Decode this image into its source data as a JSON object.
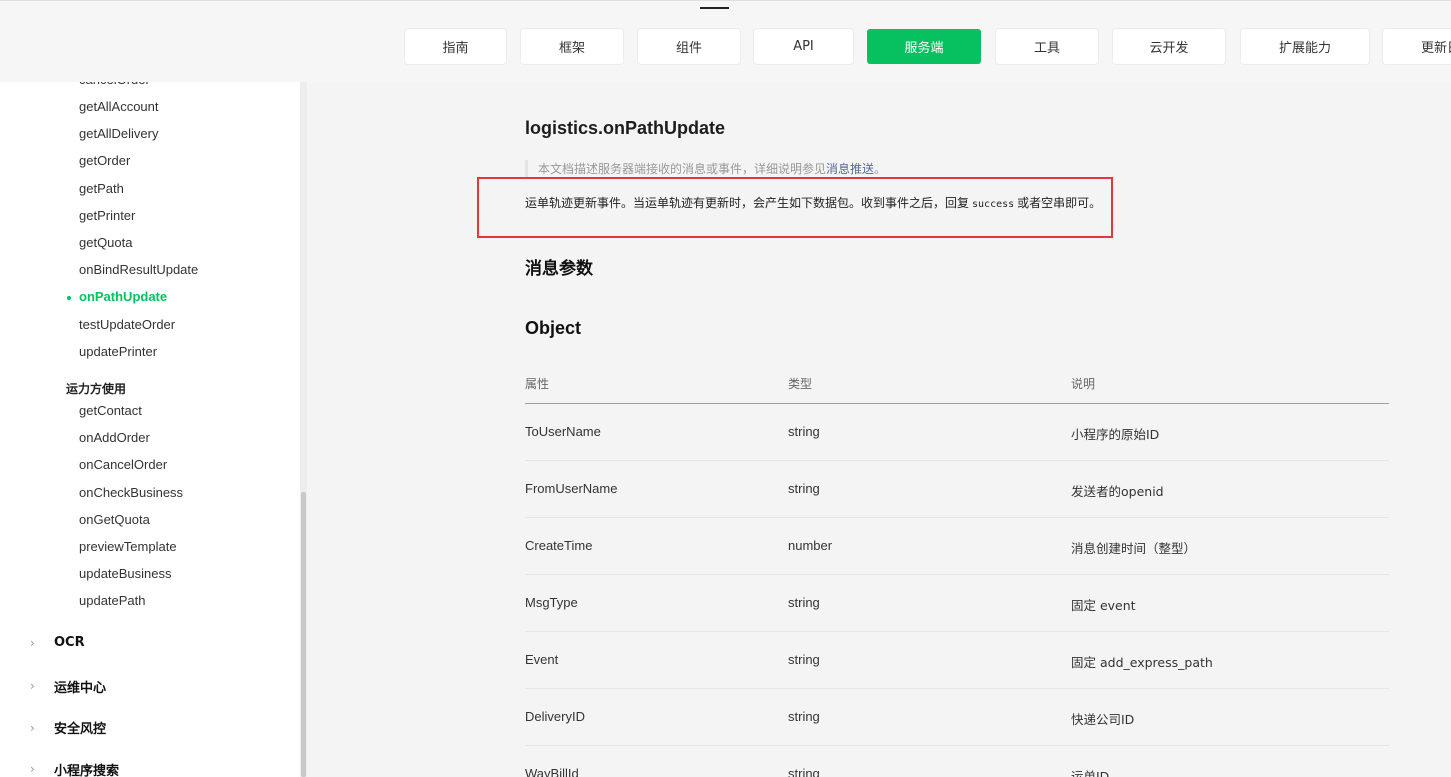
{
  "nav": {
    "tabs": [
      {
        "label": "指南",
        "active": false
      },
      {
        "label": "框架",
        "active": false
      },
      {
        "label": "组件",
        "active": false
      },
      {
        "label": "API",
        "active": false
      },
      {
        "label": "服务端",
        "active": true
      },
      {
        "label": "工具",
        "active": false
      },
      {
        "label": "云开发",
        "active": false
      },
      {
        "label": "扩展能力",
        "active": false
      },
      {
        "label": "更新日",
        "active": false
      }
    ],
    "active_color": "#07c160"
  },
  "sidebar": {
    "cut_item": "cancelOrder",
    "items_a": [
      "getAllAccount",
      "getAllDelivery",
      "getOrder",
      "getPath",
      "getPrinter",
      "getQuota",
      "onBindResultUpdate",
      "onPathUpdate",
      "testUpdateOrder",
      "updatePrinter"
    ],
    "active_item": "onPathUpdate",
    "group_label": "运力方使用",
    "items_b": [
      "getContact",
      "onAddOrder",
      "onCancelOrder",
      "onCheckBusiness",
      "onGetQuota",
      "previewTemplate",
      "updateBusiness",
      "updatePath"
    ],
    "sections": [
      "OCR",
      "运维中心",
      "安全风控",
      "小程序搜索"
    ]
  },
  "main": {
    "title": "logistics.onPathUpdate",
    "notice_text": "本文档描述服务器端接收的消息或事件，详细说明参见",
    "notice_link": "消息推送",
    "notice_end": "。",
    "desc_before": "运单轨迹更新事件。当运单轨迹有更新时，会产生如下数据包。收到事件之后，回复",
    "desc_code": "success",
    "desc_after": "或者空串即可。",
    "section_title": "消息参数",
    "object_title": "Object",
    "highlight_color": "#e2373b",
    "table": {
      "headers": [
        "属性",
        "类型",
        "说明"
      ],
      "rows": [
        [
          "ToUserName",
          "string",
          "小程序的原始ID"
        ],
        [
          "FromUserName",
          "string",
          "发送者的openid"
        ],
        [
          "CreateTime",
          "number",
          "消息创建时间（整型）"
        ],
        [
          "MsgType",
          "string",
          "固定 event"
        ],
        [
          "Event",
          "string",
          "固定 add_express_path"
        ],
        [
          "DeliveryID",
          "string",
          "快递公司ID"
        ],
        [
          "WayBillId",
          "string",
          "运单ID"
        ]
      ]
    }
  }
}
